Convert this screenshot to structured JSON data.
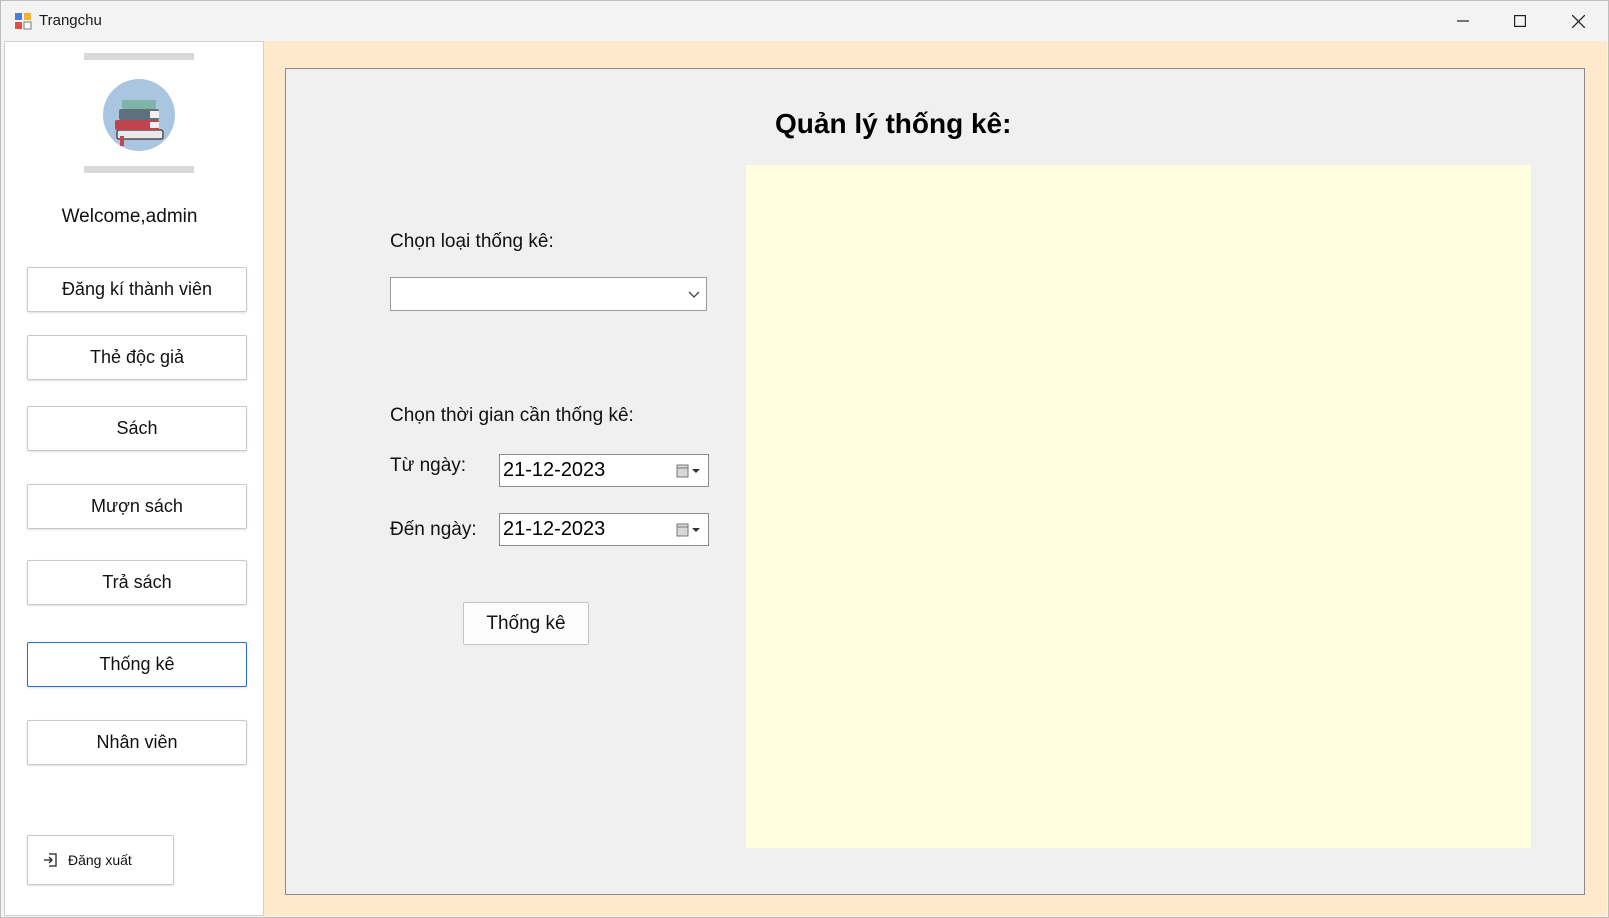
{
  "window": {
    "title": "Trangchu"
  },
  "sidebar": {
    "welcome": "Welcome,admin",
    "items": [
      {
        "label": "Đăng kí thành viên"
      },
      {
        "label": "Thẻ độc giả"
      },
      {
        "label": "Sách"
      },
      {
        "label": "Mượn sách"
      },
      {
        "label": "Trả sách"
      },
      {
        "label": "Thống kê",
        "active": true
      },
      {
        "label": "Nhân viên"
      }
    ],
    "logout_label": "Đăng xuất"
  },
  "main": {
    "title": "Quản lý thống kê:",
    "type_label": "Chọn loại thống kê:",
    "type_value": "",
    "time_label": "Chọn thời gian cần thống kê:",
    "from_label": "Từ ngày:",
    "from_value": "21-12-2023",
    "to_label": "Đến ngày:",
    "to_value": "21-12-2023",
    "submit_label": "Thống kê"
  },
  "colors": {
    "content_bg": "#ffe9cc",
    "panel_bg": "#f0f0f0",
    "chart_bg": "#ffffe0",
    "active_border": "#2c6bc4"
  },
  "icons": [
    "app-icon",
    "minimize-icon",
    "maximize-icon",
    "close-icon",
    "books-avatar-icon",
    "logout-icon",
    "chevron-down-icon",
    "calendar-icon"
  ]
}
